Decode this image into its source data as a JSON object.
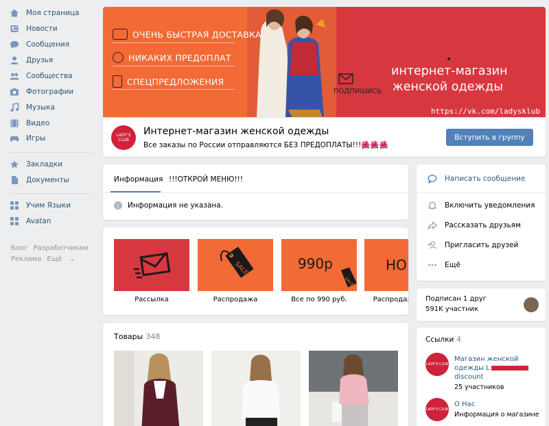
{
  "nav": {
    "items": [
      {
        "label": "Моя страница",
        "icon": "home-icon"
      },
      {
        "label": "Новости",
        "icon": "news-icon"
      },
      {
        "label": "Сообщения",
        "icon": "messages-icon"
      },
      {
        "label": "Друзья",
        "icon": "friends-icon"
      },
      {
        "label": "Сообщества",
        "icon": "communities-icon"
      },
      {
        "label": "Фотографии",
        "icon": "camera-icon"
      },
      {
        "label": "Музыка",
        "icon": "music-icon"
      },
      {
        "label": "Видео",
        "icon": "video-icon"
      },
      {
        "label": "Игры",
        "icon": "games-icon"
      },
      {
        "label": "Закладки",
        "icon": "star-icon"
      },
      {
        "label": "Документы",
        "icon": "document-icon"
      },
      {
        "label": "Учим Языки",
        "icon": "app-icon"
      },
      {
        "label": "Avatan",
        "icon": "app-icon"
      }
    ],
    "footer": {
      "blog": "Блог",
      "dev": "Разработчикам",
      "ads": "Реклама",
      "more": "Ещё"
    }
  },
  "cover": {
    "line1": "ОЧЕНЬ БЫСТРАЯ ДОСТАВКА",
    "line2": "НИКАКИХ ПРЕДОПЛАТ",
    "line3": "СПЕЦПРЕДЛОЖЕНИЯ",
    "title_line1": "интернет-магазин",
    "title_line2": "женской одежды",
    "subscribe": "ПОДПИШИСЬ",
    "url": "https://vk.com/ladysklub"
  },
  "header": {
    "avatar_text": "LADY'S CLUB",
    "title": "Интернет-магазин женской одежды",
    "status": "Все заказы по России отправляются БЕЗ ПРЕДОПЛАТЫ!!!🌺🌺🌺",
    "join_label": "Вступить в группу"
  },
  "info": {
    "tab_active": "Информация",
    "tab_menu": "!!!ОТКРОЙ МЕНЮ!!!",
    "empty_text": "Информация не указана."
  },
  "menu": {
    "tiles": [
      {
        "label": "Рассылка",
        "color": "#d7383f"
      },
      {
        "label": "Распродажа",
        "color": "#f26a36",
        "tag": "SALE"
      },
      {
        "label": "Все по 990 руб.",
        "color": "#f26a36",
        "price": "990р",
        "tag": "SALE"
      },
      {
        "label": "Распродажа",
        "color": "#f26a36",
        "partial": "HO"
      }
    ]
  },
  "products": {
    "title": "Товары",
    "count": "348"
  },
  "actions": {
    "message": "Написать сообщение",
    "notify": "Включить уведомления",
    "share": "Рассказать друзьям",
    "invite": "Пригласить друзей",
    "more": "Ещё"
  },
  "subs": {
    "friend": "Подписан 1 друг",
    "members": "591K участник"
  },
  "links": {
    "title": "Ссылки",
    "count": "4",
    "items": [
      {
        "title": "Магазин женской одежды L",
        "title2": "discount",
        "sub": "25 участников",
        "avatar_text": "LADY'S CLUB"
      },
      {
        "title": "О Нас",
        "sub": "Информация о магазине",
        "avatar_text": "LADY'S CLUB"
      }
    ]
  },
  "colors": {
    "accent": "#5181b8",
    "link": "#2a5885",
    "brand_red": "#d0223a",
    "orange": "#f26a36"
  }
}
